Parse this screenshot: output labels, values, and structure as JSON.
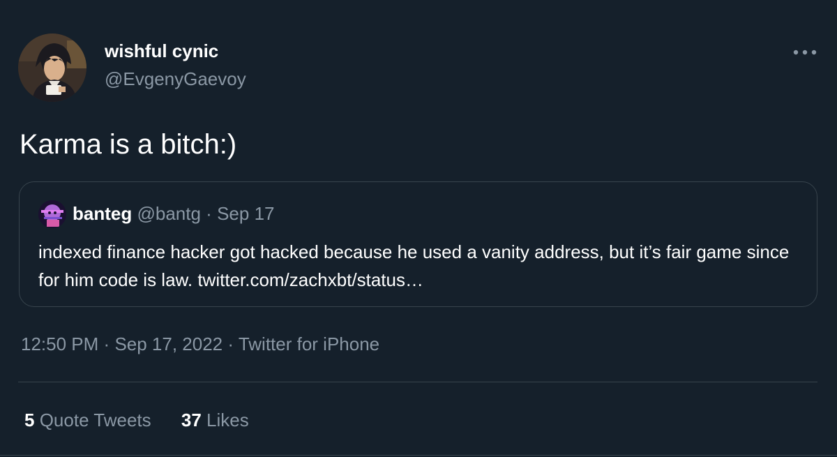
{
  "author": {
    "display_name": "wishful cynic",
    "handle": "@EvgenyGaevoy",
    "avatar_icon": "anime-character-avatar"
  },
  "tweet": {
    "text": "Karma is a bitch:)"
  },
  "quoted_tweet": {
    "display_name": "banteg",
    "handle": "@bantg",
    "separator": "·",
    "date": "Sep 17",
    "text": "indexed finance hacker got hacked because he used a vanity address, but it’s fair game since for him code is law. twitter.com/zachxbt/status…",
    "avatar_icon": "purple-glitch-avatar"
  },
  "meta": {
    "time": "12:50 PM",
    "sep1": "·",
    "date": "Sep 17, 2022",
    "sep2": "·",
    "source": "Twitter for iPhone"
  },
  "stats": {
    "quote_tweets_count": "5",
    "quote_tweets_label": "Quote Tweets",
    "likes_count": "37",
    "likes_label": "Likes"
  },
  "colors": {
    "background": "#15202b",
    "secondary_text": "#8b98a5",
    "border": "#38444d",
    "primary_text": "#ffffff"
  }
}
